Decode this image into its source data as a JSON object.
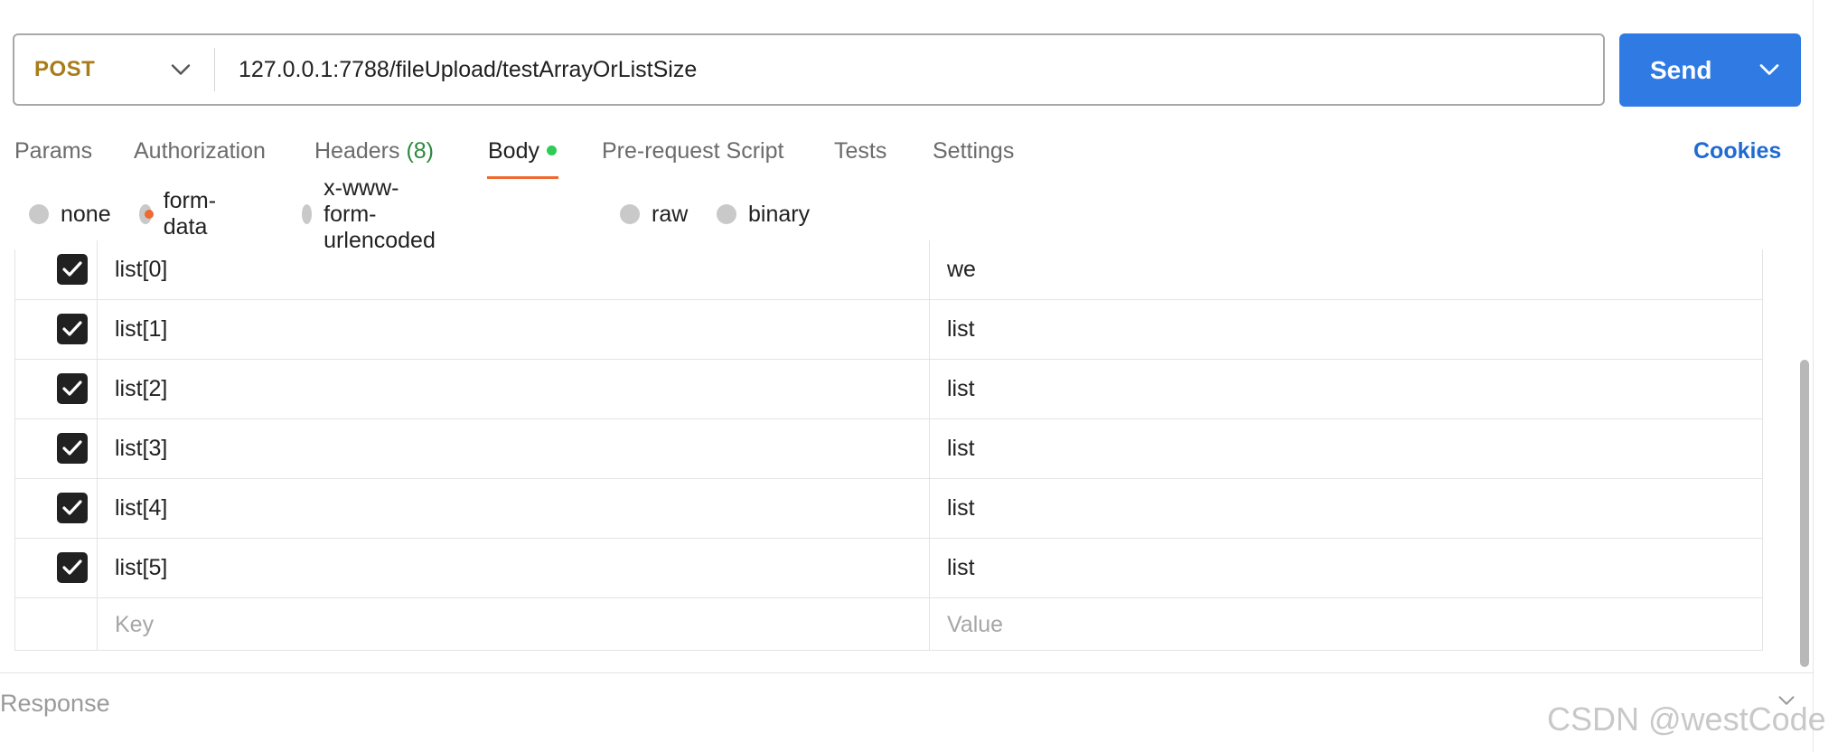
{
  "request": {
    "method": "POST",
    "url": "127.0.0.1:7788/fileUpload/testArrayOrListSize",
    "send_label": "Send"
  },
  "tabs": [
    {
      "label": "Params"
    },
    {
      "label": "Authorization"
    },
    {
      "label": "Headers",
      "count": "(8)"
    },
    {
      "label": "Body",
      "active": true
    },
    {
      "label": "Pre-request Script"
    },
    {
      "label": "Tests"
    },
    {
      "label": "Settings"
    }
  ],
  "cookies_label": "Cookies",
  "body_types": [
    {
      "label": "none",
      "selected": false
    },
    {
      "label": "form-data",
      "selected": true
    },
    {
      "label": "x-www-form-urlencoded",
      "selected": false
    },
    {
      "label": "raw",
      "selected": false
    },
    {
      "label": "binary",
      "selected": false
    }
  ],
  "form_rows": [
    {
      "key": "list[0]",
      "value": "we",
      "checked": true
    },
    {
      "key": "list[1]",
      "value": "list",
      "checked": true
    },
    {
      "key": "list[2]",
      "value": "list",
      "checked": true
    },
    {
      "key": "list[3]",
      "value": "list",
      "checked": true
    },
    {
      "key": "list[4]",
      "value": "list",
      "checked": true
    },
    {
      "key": "list[5]",
      "value": "list",
      "checked": true
    }
  ],
  "new_row": {
    "key_placeholder": "Key",
    "value_placeholder": "Value"
  },
  "response_label": "Response",
  "watermark": "CSDN @westCode",
  "colors": {
    "accent": "#ee6a2f",
    "send": "#2f7be3",
    "method": "#a87c1a",
    "cookies": "#1f6bd2",
    "dot": "#2ecc55"
  }
}
